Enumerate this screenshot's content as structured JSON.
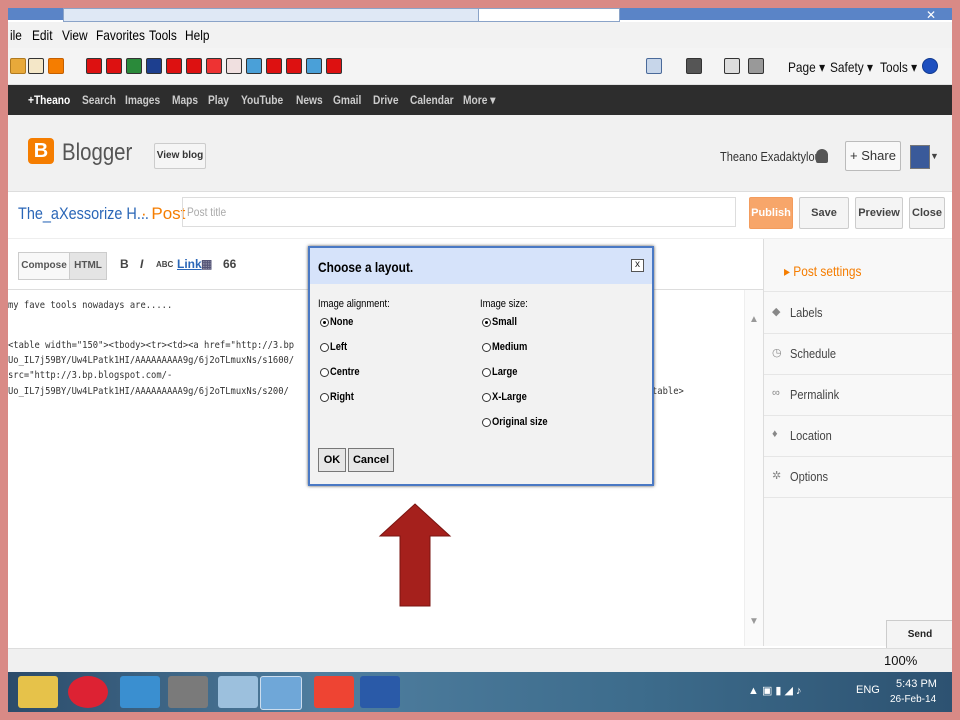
{
  "browser": {
    "menu": [
      "ile",
      "Edit",
      "View",
      "Favorites",
      "Tools",
      "Help"
    ],
    "right_commands": [
      "Page ▾",
      "Safety ▾",
      "Tools ▾"
    ]
  },
  "google_bar": {
    "items": [
      "+Theano",
      "Search",
      "Images",
      "Maps",
      "Play",
      "YouTube",
      "News",
      "Gmail",
      "Drive",
      "Calendar",
      "More ▾"
    ]
  },
  "blogger": {
    "logo_letter": "B",
    "brand": "Blogger",
    "view_blog": "View blog",
    "user_name": "Theano Exadaktylou",
    "share": "+ Share",
    "blog_title": "The_aXessorize H...",
    "post_label": "· Post",
    "post_title_placeholder": "Post title",
    "buttons": [
      "Publish",
      "Save",
      "Preview",
      "Close"
    ],
    "compose_label": "Compose",
    "html_label": "HTML",
    "format_tools": [
      "B",
      "I",
      "ABC",
      "Link",
      "▦",
      "66"
    ]
  },
  "editor": {
    "lines": [
      "my fave tools nowadays are.....",
      "",
      "<table width=\"150\"><tbody><tr><td><a href=\"http://3.bp",
      "Uo_IL7j59BY/Uw4LPatk1HI/AAAAAAAAA9g/6j2oTLmuxNs/s1600/",
      "src=\"http://3.bp.blogspot.com/-",
      "Uo_IL7j59BY/Uw4LPatk1HI/AAAAAAAAA9g/6j2oTLmuxNs/s200/"
    ],
    "tail_text": "table>"
  },
  "post_settings": {
    "heading": "▸ Post settings",
    "items": [
      {
        "label": "Labels",
        "icon": "tag-icon",
        "glyph": "◆"
      },
      {
        "label": "Schedule",
        "icon": "clock-icon",
        "glyph": "◷"
      },
      {
        "label": "Permalink",
        "icon": "link-icon",
        "glyph": "∞"
      },
      {
        "label": "Location",
        "icon": "pin-icon",
        "glyph": "♦"
      },
      {
        "label": "Options",
        "icon": "gear-icon",
        "glyph": "✲"
      }
    ]
  },
  "dialog": {
    "title": "Choose a layout.",
    "close": "x",
    "alignment_label": "Image alignment:",
    "alignment_options": [
      {
        "label": "None",
        "selected": true
      },
      {
        "label": "Left",
        "selected": false
      },
      {
        "label": "Centre",
        "selected": false
      },
      {
        "label": "Right",
        "selected": false
      }
    ],
    "size_label": "Image size:",
    "size_options": [
      {
        "label": "Small",
        "selected": true
      },
      {
        "label": "Medium",
        "selected": false
      },
      {
        "label": "Large",
        "selected": false
      },
      {
        "label": "X-Large",
        "selected": false
      },
      {
        "label": "Original size",
        "selected": false
      }
    ],
    "ok": "OK",
    "cancel": "Cancel"
  },
  "feedback": "Send feedback",
  "status": {
    "zoom": "100%"
  },
  "taskbar": {
    "language": "ENG",
    "time": "5:43 PM",
    "date": "26-Feb-14"
  },
  "colors": {
    "frame": "#d98a86",
    "blogger_orange": "#f57d00",
    "arrow": "#a5201c",
    "dialog_border": "#4a79c4"
  }
}
